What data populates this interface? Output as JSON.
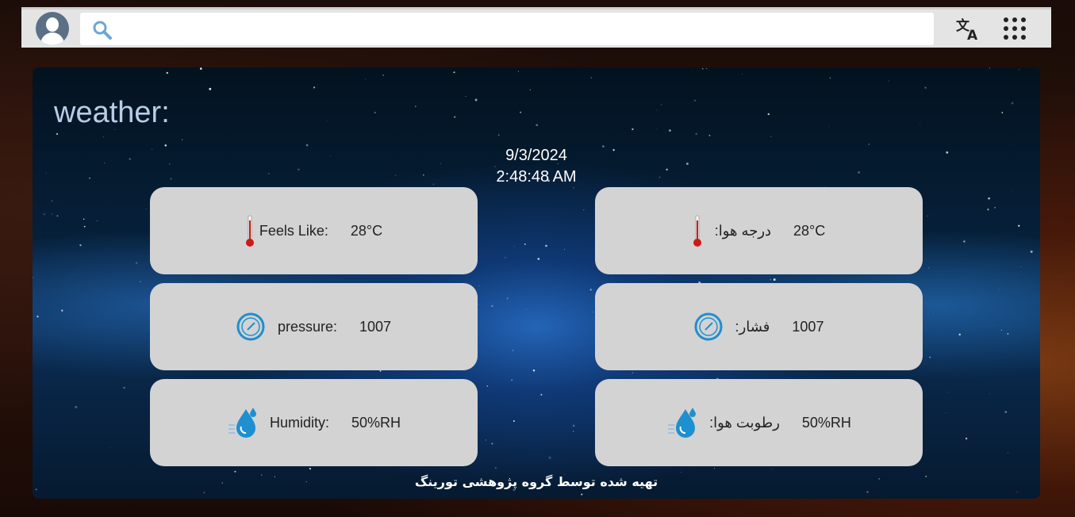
{
  "topbar": {
    "search": {
      "placeholder": "",
      "value": ""
    }
  },
  "panel": {
    "title": "weather:",
    "date": "9/3/2024",
    "time": "2:48:48 AM",
    "cards": {
      "feels_like": {
        "label": "Feels Like:",
        "value": "28°C",
        "icon": "thermometer-icon"
      },
      "temperature_fa": {
        "label": ":درجه هوا",
        "value": "28°C",
        "icon": "thermometer-icon"
      },
      "pressure": {
        "label": "pressure:",
        "value": "1007",
        "icon": "gauge-icon"
      },
      "pressure_fa": {
        "label": ":فشار",
        "value": "1007",
        "icon": "gauge-icon"
      },
      "humidity": {
        "label": "Humidity:",
        "value": "50%RH",
        "icon": "water-drop-icon"
      },
      "humidity_fa": {
        "label": ":رطوبت هوا",
        "value": "50%RH",
        "icon": "water-drop-icon"
      }
    },
    "footer": "تهیه شده توسط گروه پژوهشی تورینگ"
  },
  "colors": {
    "card_bg": "#d3d3d3",
    "title": "#b9cde6",
    "icon_blue": "#1e8fd0",
    "thermo_red": "#d01818"
  }
}
